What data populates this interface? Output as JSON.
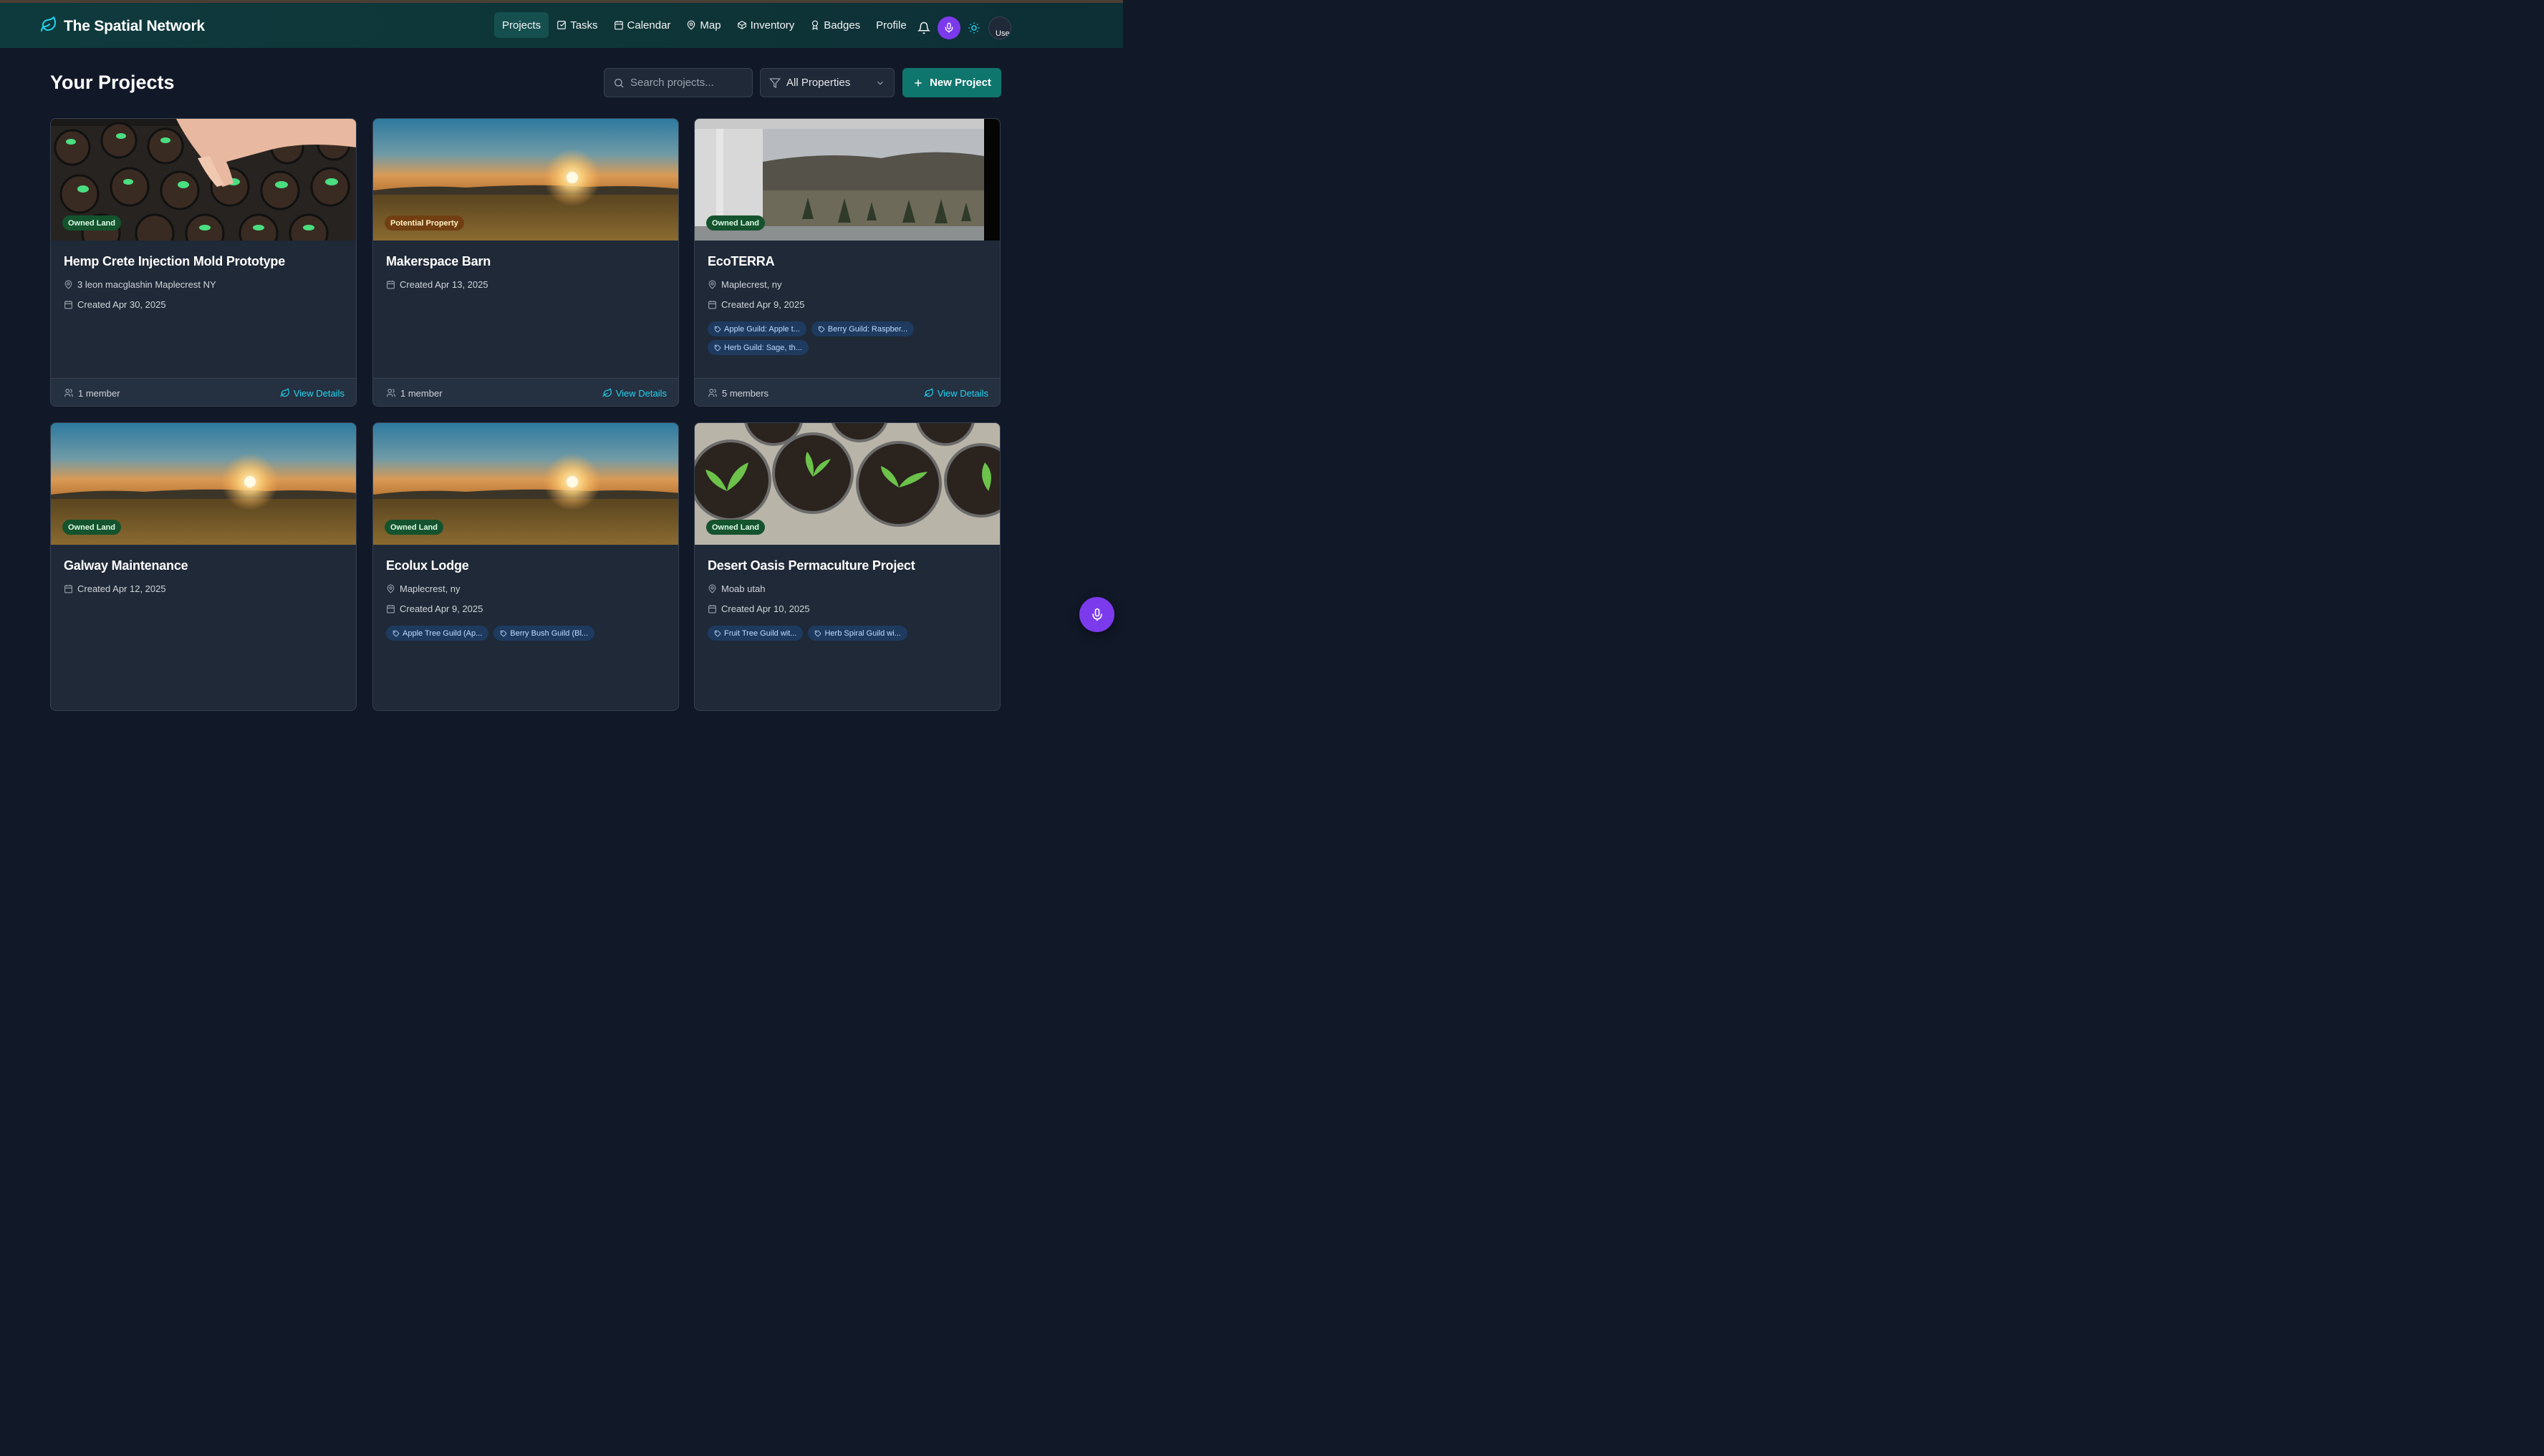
{
  "app": {
    "title": "The Spatial Network"
  },
  "nav": {
    "items": [
      {
        "label": "Projects",
        "icon": "none",
        "active": true
      },
      {
        "label": "Tasks",
        "icon": "check-square-icon"
      },
      {
        "label": "Calendar",
        "icon": "calendar-icon"
      },
      {
        "label": "Map",
        "icon": "map-pin-icon"
      },
      {
        "label": "Inventory",
        "icon": "package-icon"
      },
      {
        "label": "Badges",
        "icon": "award-icon"
      },
      {
        "label": "Profile",
        "icon": "none"
      }
    ],
    "avatar_alt": "Use"
  },
  "page": {
    "title": "Your Projects",
    "search_placeholder": "Search projects...",
    "filter_label": "All Properties",
    "new_button": "New Project"
  },
  "cards": [
    {
      "badge": "Owned Land",
      "badge_type": "owned",
      "title": "Hemp Crete Injection Mold Prototype",
      "location": "3 leon macglashin Maplecrest NY",
      "created": "Created Apr 30, 2025",
      "tags": [],
      "members": "1 member",
      "view": "View Details",
      "image": "seedling-trays"
    },
    {
      "badge": "Potential Property",
      "badge_type": "potential",
      "title": "Makerspace Barn",
      "location": "",
      "created": "Created Apr 13, 2025",
      "tags": [],
      "members": "1 member",
      "view": "View Details",
      "image": "sunset-field"
    },
    {
      "badge": "Owned Land",
      "badge_type": "owned",
      "title": "EcoTERRA",
      "location": "Maplecrest, ny",
      "created": "Created Apr 9, 2025",
      "tags": [
        "Apple Guild: Apple t...",
        "Berry Guild: Raspber...",
        "Herb Guild: Sage, th..."
      ],
      "members": "5 members",
      "view": "View Details",
      "image": "porch-view"
    },
    {
      "badge": "Owned Land",
      "badge_type": "owned",
      "title": "Galway Maintenance",
      "location": "",
      "created": "Created Apr 12, 2025",
      "tags": [],
      "members": "",
      "view": "",
      "image": "sunset-field"
    },
    {
      "badge": "Owned Land",
      "badge_type": "owned",
      "title": "Ecolux Lodge",
      "location": "Maplecrest, ny",
      "created": "Created Apr 9, 2025",
      "tags": [
        "Apple Tree Guild (Ap...",
        "Berry Bush Guild (Bl..."
      ],
      "members": "",
      "view": "",
      "image": "sunset-field"
    },
    {
      "badge": "Owned Land",
      "badge_type": "owned",
      "title": "Desert Oasis Permaculture Project",
      "location": "Moab utah",
      "created": "Created Apr 10, 2025",
      "tags": [
        "Fruit Tree Guild wit...",
        "Herb Spiral Guild wi..."
      ],
      "members": "",
      "view": "",
      "image": "seedling-pots"
    }
  ],
  "colors": {
    "accent": "#0f766e",
    "link": "#22d3ee",
    "mic": "#7c3aed",
    "background": "#111827",
    "card": "#1f2937"
  }
}
